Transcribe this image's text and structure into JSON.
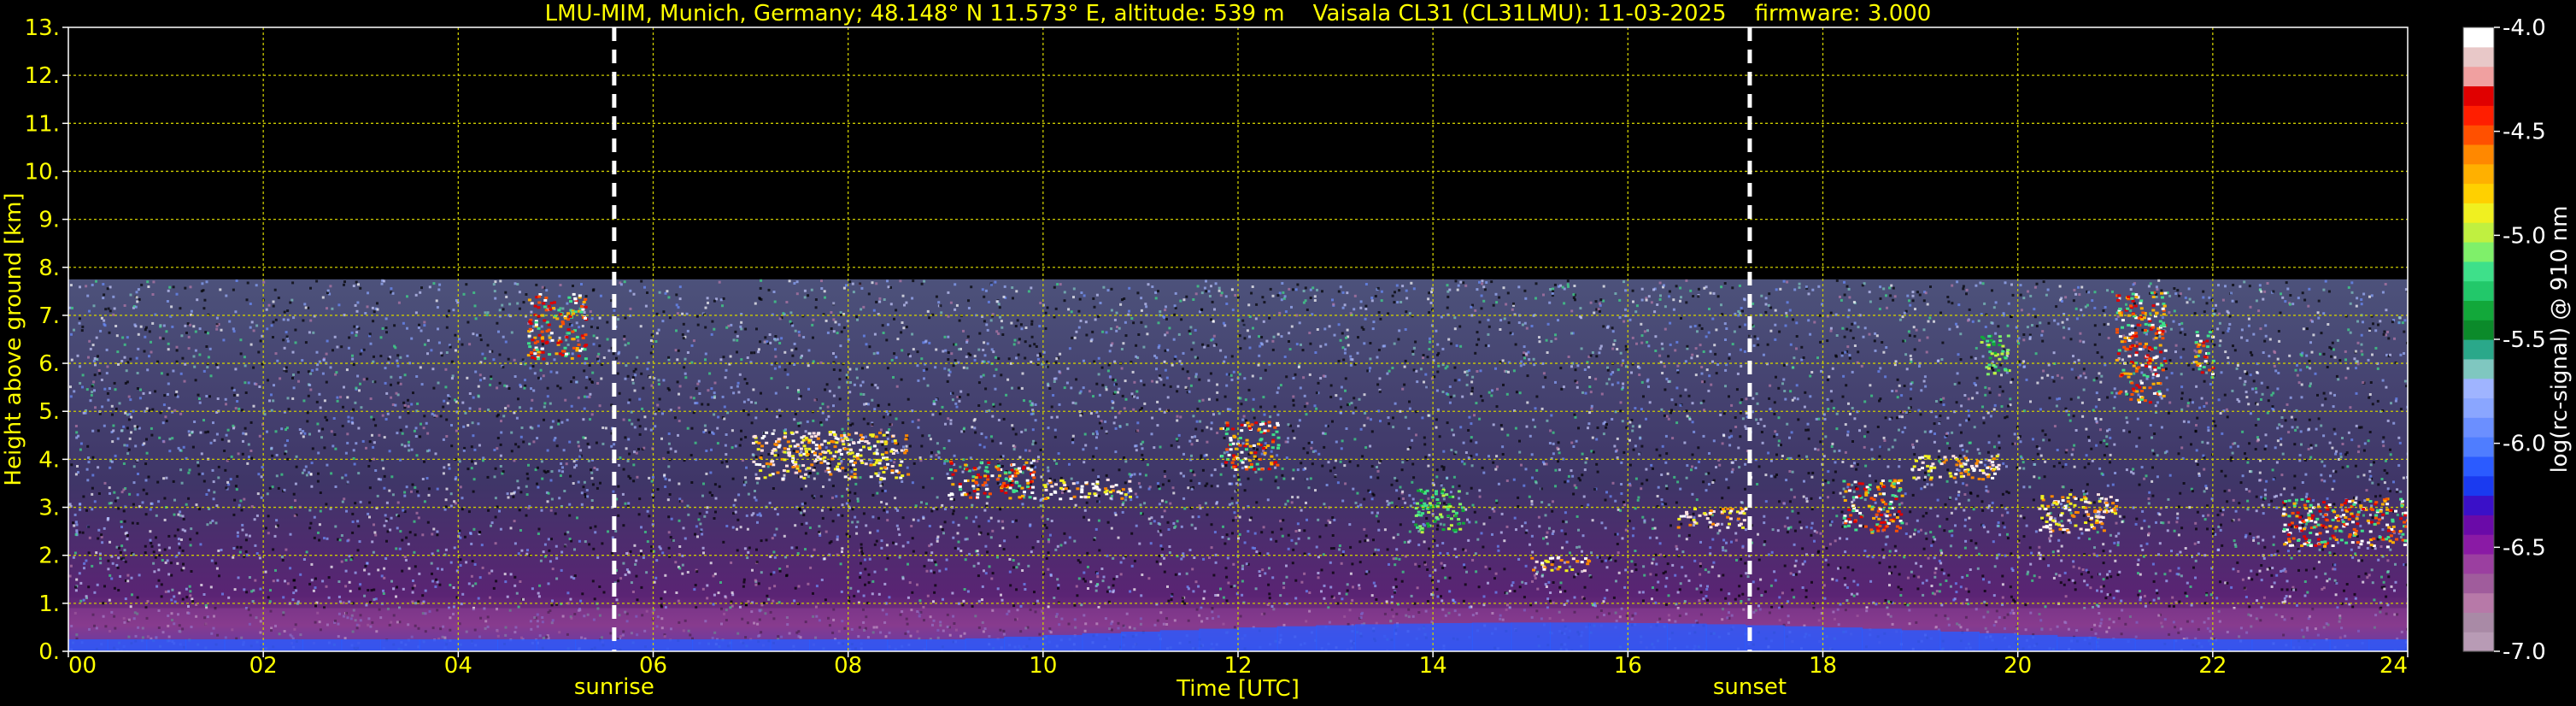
{
  "chart_data": {
    "type": "heatmap",
    "title": "LMU-MIM, Munich, Germany; 48.148° N 11.573° E, altitude: 539 m    Vaisala CL31 (CL31LMU): 11-03-2025    firmware: 3.000",
    "xlabel": "Time [UTC]",
    "ylabel": "Height above ground [km]",
    "xlim": [
      0,
      24
    ],
    "ylim": [
      0,
      13
    ],
    "x_ticks": [
      "00",
      "02",
      "04",
      "06",
      "08",
      "10",
      "12",
      "14",
      "16",
      "18",
      "20",
      "22",
      "24"
    ],
    "y_ticks": [
      "0.",
      "1.",
      "2.",
      "3.",
      "4.",
      "5.",
      "6.",
      "7.",
      "8.",
      "9.",
      "10.",
      "11.",
      "12.",
      "13."
    ],
    "grid": true,
    "grid_color": "#cccc00",
    "text_color": "#ffff00",
    "signal_top_km": 7.75,
    "markers": [
      {
        "label": "sunrise",
        "time": 5.6
      },
      {
        "label": "sunset",
        "time": 17.25
      }
    ],
    "colorbar": {
      "label": "log(rc-signal) @ 910 nm",
      "ticks": [
        "-4.0",
        "-4.5",
        "-5.0",
        "-5.5",
        "-6.0",
        "-6.5",
        "-7.0"
      ],
      "range": [
        -7.0,
        -4.0
      ],
      "colors": [
        "#b89bb5",
        "#a98aa6",
        "#b779a8",
        "#a05c9c",
        "#9b3fa0",
        "#8a1aa5",
        "#6a0aa8",
        "#3a10c8",
        "#1a3af0",
        "#2b5bff",
        "#4f7dff",
        "#6b8fff",
        "#8aa6ff",
        "#9fb4ff",
        "#7fc7c0",
        "#2aa88a",
        "#0b8a2a",
        "#12a83a",
        "#22c86a",
        "#3ee08a",
        "#7ff06a",
        "#c0f040",
        "#f0f020",
        "#ffd000",
        "#ffb000",
        "#ff8800",
        "#ff5000",
        "#ff1e00",
        "#e00000",
        "#f0a0a0",
        "#e8c8c8",
        "#ffffff"
      ]
    },
    "cloud_layers": [
      {
        "t0": 4.7,
        "t1": 5.3,
        "h0": 6.1,
        "h1": 7.5,
        "level": "orange"
      },
      {
        "t0": 7.0,
        "t1": 8.6,
        "h0": 3.6,
        "h1": 4.6,
        "level": "white"
      },
      {
        "t0": 9.0,
        "t1": 9.9,
        "h0": 3.2,
        "h1": 4.0,
        "level": "orange"
      },
      {
        "t0": 10.0,
        "t1": 10.9,
        "h0": 3.2,
        "h1": 3.6,
        "level": "white"
      },
      {
        "t0": 11.8,
        "t1": 12.4,
        "h0": 3.8,
        "h1": 4.8,
        "level": "orange"
      },
      {
        "t0": 13.8,
        "t1": 14.3,
        "h0": 2.5,
        "h1": 3.4,
        "level": "green"
      },
      {
        "t0": 15.0,
        "t1": 15.6,
        "h0": 1.7,
        "h1": 2.0,
        "level": "white"
      },
      {
        "t0": 16.5,
        "t1": 17.2,
        "h0": 2.6,
        "h1": 3.0,
        "level": "white"
      },
      {
        "t0": 18.2,
        "t1": 18.8,
        "h0": 2.5,
        "h1": 3.6,
        "level": "orange"
      },
      {
        "t0": 18.9,
        "t1": 19.8,
        "h0": 3.6,
        "h1": 4.1,
        "level": "white"
      },
      {
        "t0": 19.6,
        "t1": 19.9,
        "h0": 5.8,
        "h1": 6.6,
        "level": "green"
      },
      {
        "t0": 20.2,
        "t1": 21.0,
        "h0": 2.5,
        "h1": 3.3,
        "level": "white"
      },
      {
        "t0": 21.0,
        "t1": 21.5,
        "h0": 5.2,
        "h1": 7.5,
        "level": "orange"
      },
      {
        "t0": 21.8,
        "t1": 22.0,
        "h0": 5.7,
        "h1": 6.7,
        "level": "orange"
      },
      {
        "t0": 22.7,
        "t1": 24.0,
        "h0": 2.2,
        "h1": 3.2,
        "level": "orange"
      }
    ]
  }
}
